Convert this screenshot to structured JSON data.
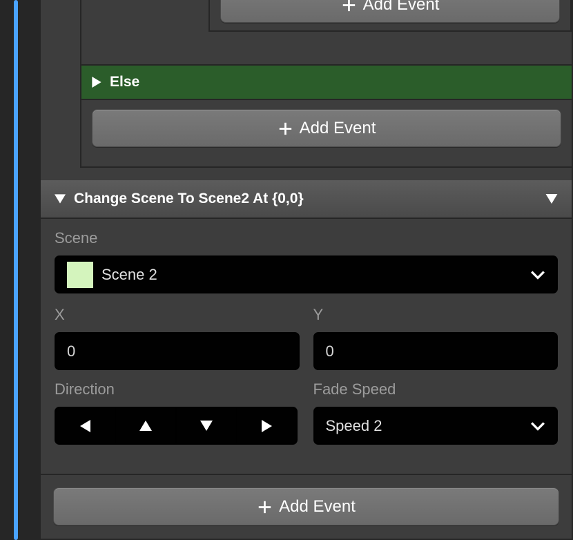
{
  "add_event_label": "Add Event",
  "if_block": {
    "else_label": "Else"
  },
  "change_scene": {
    "header": "Change Scene To Scene2 At {0,0}",
    "scene_label": "Scene",
    "scene_value": "Scene 2",
    "scene_swatch_color": "#d5f3bc",
    "x_label": "X",
    "x_value": "0",
    "y_label": "Y",
    "y_value": "0",
    "direction_label": "Direction",
    "fade_speed_label": "Fade Speed",
    "fade_speed_value": "Speed 2"
  }
}
